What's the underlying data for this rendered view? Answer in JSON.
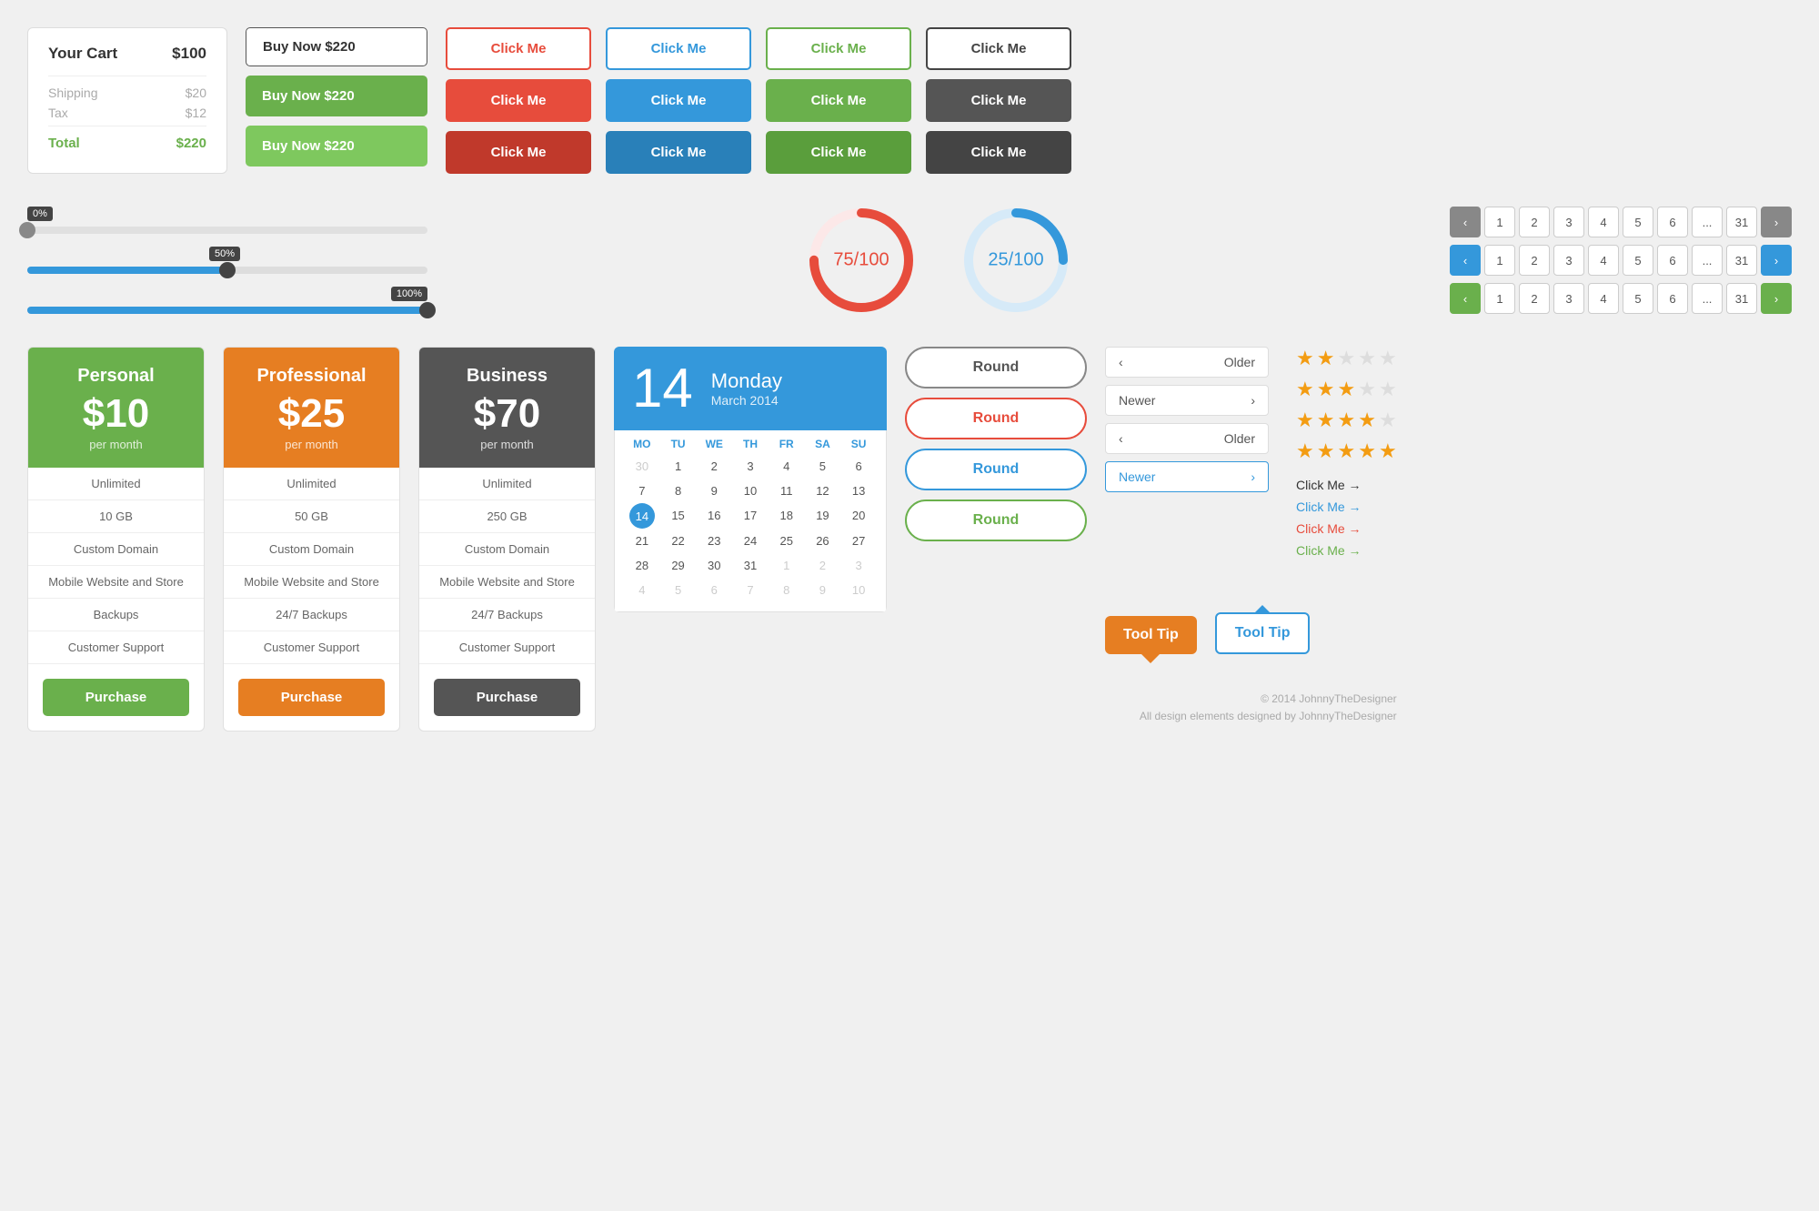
{
  "cart": {
    "title": "Your Cart",
    "total_header": "$100",
    "shipping_label": "Shipping",
    "shipping_value": "$20",
    "tax_label": "Tax",
    "tax_value": "$12",
    "total_label": "Total",
    "total_value": "$220"
  },
  "buy_now": {
    "outline": "Buy Now  $220",
    "green1": "Buy Now  $220",
    "green2": "Buy Now  $220"
  },
  "click_buttons": {
    "label": "Click Me"
  },
  "sliders": [
    {
      "label": "0%",
      "value": 0,
      "percent": 0
    },
    {
      "label": "50%",
      "value": 50,
      "percent": 50
    },
    {
      "label": "100%",
      "value": 100,
      "percent": 100
    }
  ],
  "circles": [
    {
      "value": "75/100",
      "color": "#e74c3c",
      "bg": "#fce8e8",
      "percent": 75
    },
    {
      "value": "25/100",
      "color": "#3498db",
      "bg": "#e8f4fc",
      "percent": 25
    }
  ],
  "pagination": {
    "pages": [
      "1",
      "2",
      "3",
      "4",
      "5",
      "6",
      "...",
      "31"
    ],
    "nav_prev": "‹",
    "nav_next": "›"
  },
  "pricing": [
    {
      "plan": "Personal",
      "price": "$10",
      "period": "per month",
      "color": "green",
      "features": [
        "Unlimited",
        "10 GB",
        "Custom Domain",
        "Mobile Website and Store",
        "Backups",
        "Customer Support"
      ],
      "button": "Purchase"
    },
    {
      "plan": "Professional",
      "price": "$25",
      "period": "per month",
      "color": "orange",
      "features": [
        "Unlimited",
        "50 GB",
        "Custom Domain",
        "Mobile Website and Store",
        "24/7 Backups",
        "Customer Support"
      ],
      "button": "Purchase"
    },
    {
      "plan": "Business",
      "price": "$70",
      "period": "per month",
      "color": "dark",
      "features": [
        "Unlimited",
        "250 GB",
        "Custom Domain",
        "Mobile Website and Store",
        "24/7 Backups",
        "Customer Support"
      ],
      "button": "Purchase"
    }
  ],
  "calendar": {
    "day_num": "14",
    "day_name": "Monday",
    "month_year": "March 2014",
    "dow": [
      "MO",
      "TU",
      "WE",
      "TH",
      "FR",
      "SA",
      "SU"
    ],
    "cells": [
      "30",
      "1",
      "2",
      "3",
      "4",
      "5",
      "6",
      "7",
      "8",
      "9",
      "10",
      "11",
      "12",
      "13",
      "14",
      "15",
      "16",
      "17",
      "18",
      "19",
      "20",
      "21",
      "22",
      "23",
      "24",
      "25",
      "26",
      "27",
      "28",
      "29",
      "30",
      "31",
      "1",
      "2",
      "3",
      "4",
      "5",
      "6",
      "7",
      "8",
      "9",
      "10"
    ]
  },
  "round_buttons": [
    {
      "label": "Round",
      "style": "gray-outline"
    },
    {
      "label": "Round",
      "style": "red-outline"
    },
    {
      "label": "Round",
      "style": "blue-outline"
    },
    {
      "label": "Round",
      "style": "green-outline"
    }
  ],
  "nav_links": [
    {
      "label": "Older",
      "direction": "left",
      "style": "normal"
    },
    {
      "label": "Newer",
      "direction": "right",
      "style": "normal"
    },
    {
      "label": "Older",
      "direction": "left",
      "style": "normal"
    },
    {
      "label": "Newer",
      "direction": "right",
      "style": "blue"
    }
  ],
  "stars": [
    {
      "filled": 2,
      "empty": 3
    },
    {
      "filled": 3,
      "empty": 2
    },
    {
      "filled": 4,
      "empty": 1
    },
    {
      "filled": 5,
      "empty": 0
    }
  ],
  "link_buttons": [
    {
      "label": "Click Me →",
      "style": "black"
    },
    {
      "label": "Click Me →",
      "style": "blue"
    },
    {
      "label": "Click Me →",
      "style": "red"
    },
    {
      "label": "Click Me →",
      "style": "green"
    }
  ],
  "tooltips": [
    {
      "label": "Tool Tip",
      "style": "orange",
      "arrow": "down"
    },
    {
      "label": "Tool Tip",
      "style": "blue",
      "arrow": "up"
    }
  ],
  "footer": {
    "line1": "© 2014 JohnnyTheDesigner",
    "line2": "All design elements designed by JohnnyTheDesigner"
  }
}
